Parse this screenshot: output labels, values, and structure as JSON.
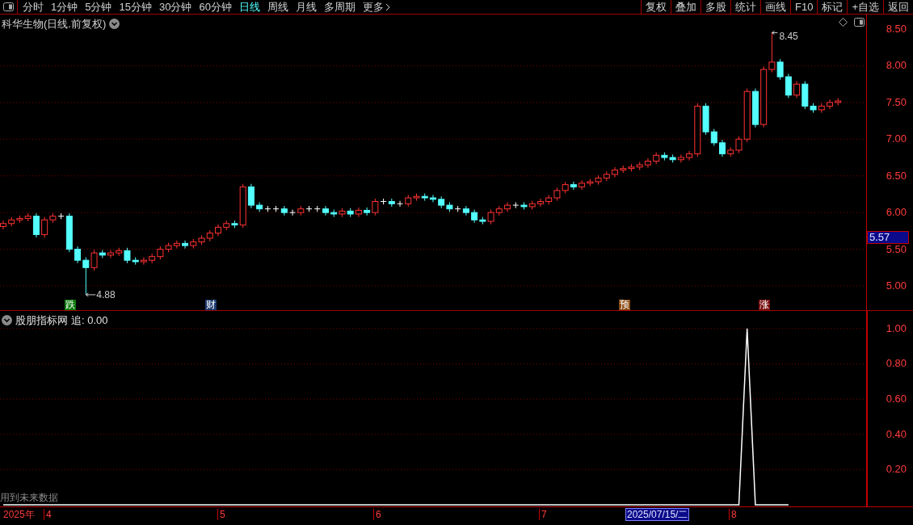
{
  "toolbar": {
    "periods": [
      {
        "label": "分时",
        "selected": false
      },
      {
        "label": "1分钟",
        "selected": false
      },
      {
        "label": "5分钟",
        "selected": false
      },
      {
        "label": "15分钟",
        "selected": false
      },
      {
        "label": "30分钟",
        "selected": false
      },
      {
        "label": "60分钟",
        "selected": false
      },
      {
        "label": "日线",
        "selected": true
      },
      {
        "label": "周线",
        "selected": false
      },
      {
        "label": "月线",
        "selected": false
      },
      {
        "label": "多周期",
        "selected": false
      }
    ],
    "more": "更多",
    "actions": [
      "复权",
      "叠加",
      "多股",
      "统计",
      "画线",
      "F10",
      "标记",
      "+自选",
      "返回"
    ]
  },
  "price_panel": {
    "title": "科华生物(日线.前复权)",
    "y_axis": [
      "8.50",
      "8.00",
      "7.50",
      "7.00",
      "6.50",
      "6.00",
      "5.50",
      "5.00"
    ],
    "current_price": "5.57",
    "high_label": "8.45",
    "low_label": "4.88",
    "event_markers": [
      {
        "label": "跌",
        "color": "#0a7a0a"
      },
      {
        "label": "财",
        "color": "#1c3a6e"
      },
      {
        "label": "预",
        "color": "#8a4a10"
      },
      {
        "label": "涨",
        "color": "#7a1010"
      }
    ]
  },
  "indicator_panel": {
    "title": "股朋指标网",
    "reading": ": 0.00",
    "note": "用到未来数据",
    "chart_data": {
      "type": "line",
      "ylim": [
        0,
        1.1
      ],
      "grid": true,
      "yticks": [
        {
          "value": 0.2,
          "label": "0.20"
        },
        {
          "value": 0.4,
          "label": "0.40"
        },
        {
          "value": 0.6,
          "label": "0.60"
        },
        {
          "value": 0.8,
          "label": "0.80"
        },
        {
          "value": 1.0,
          "label": "1.00"
        }
      ],
      "series": [
        {
          "name": "追",
          "color": "#ffffff",
          "values": [
            0,
            0,
            0,
            0,
            0,
            0,
            0,
            0,
            0,
            0,
            0,
            0,
            0,
            0,
            0,
            0,
            0,
            0,
            0,
            0,
            0,
            0,
            0,
            0,
            0,
            0,
            0,
            0,
            0,
            0,
            0,
            0,
            0,
            0,
            0,
            0,
            0,
            0,
            0,
            0,
            0,
            0,
            0,
            0,
            0,
            0,
            0,
            0,
            0,
            0,
            0,
            0,
            0,
            0,
            0,
            0,
            0,
            0,
            0,
            0,
            0,
            0,
            0,
            0,
            0,
            0,
            0,
            0,
            0,
            0,
            0,
            0,
            0,
            0,
            0,
            0,
            0,
            0,
            0,
            0,
            0,
            0,
            0,
            0,
            0,
            0,
            0,
            0,
            0,
            0,
            1,
            0,
            0,
            0,
            0,
            0
          ]
        }
      ]
    }
  },
  "time_axis": {
    "year": "2025年",
    "months": [
      "4",
      "5",
      "6",
      "7",
      "8"
    ],
    "cursor_date": "2025/07/15/二"
  }
}
